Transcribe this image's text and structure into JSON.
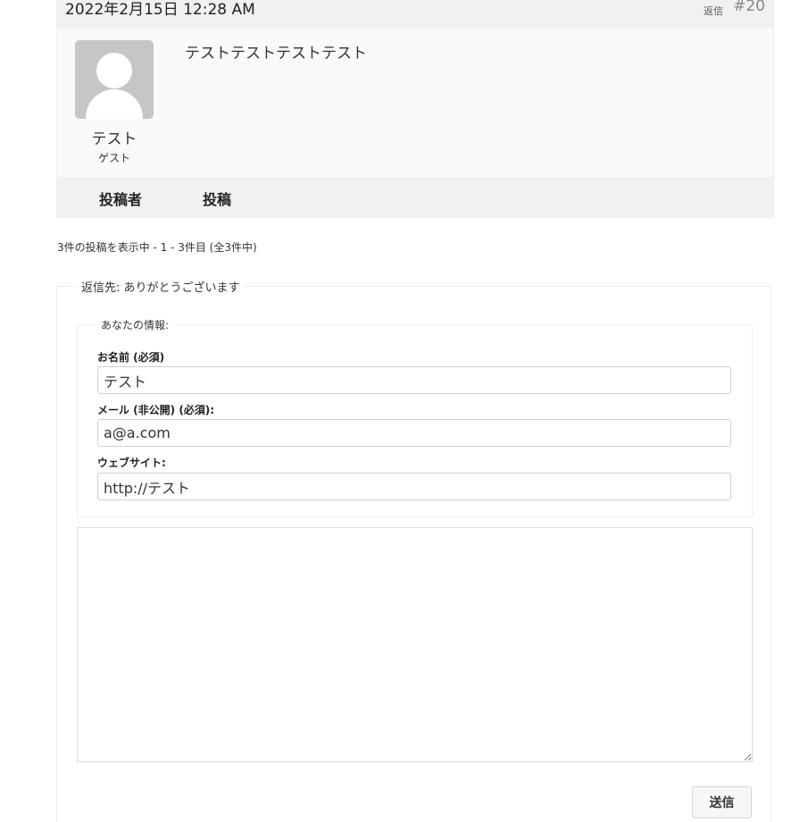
{
  "reply": {
    "date": "2022年2月15日 12:28 AM",
    "reply_link": "返信",
    "number": "#20",
    "author_name": "テスト",
    "author_role": "ゲスト",
    "content": "テストテストテストテスト"
  },
  "table_footer": {
    "author_label": "投稿者",
    "post_label": "投稿"
  },
  "pagination": {
    "count_text": "3件の投稿を表示中 - 1 - 3件目 (全3件中)"
  },
  "form": {
    "legend": "返信先: ありがとうございます",
    "info_legend": "あなたの情報:",
    "name_label": "お名前 (必須)",
    "name_value": "テスト",
    "email_label": "メール (非公開) (必須):",
    "email_value": "a@a.com",
    "website_label": "ウェブサイト:",
    "website_value": "http://テスト",
    "submit_label": "送信"
  }
}
